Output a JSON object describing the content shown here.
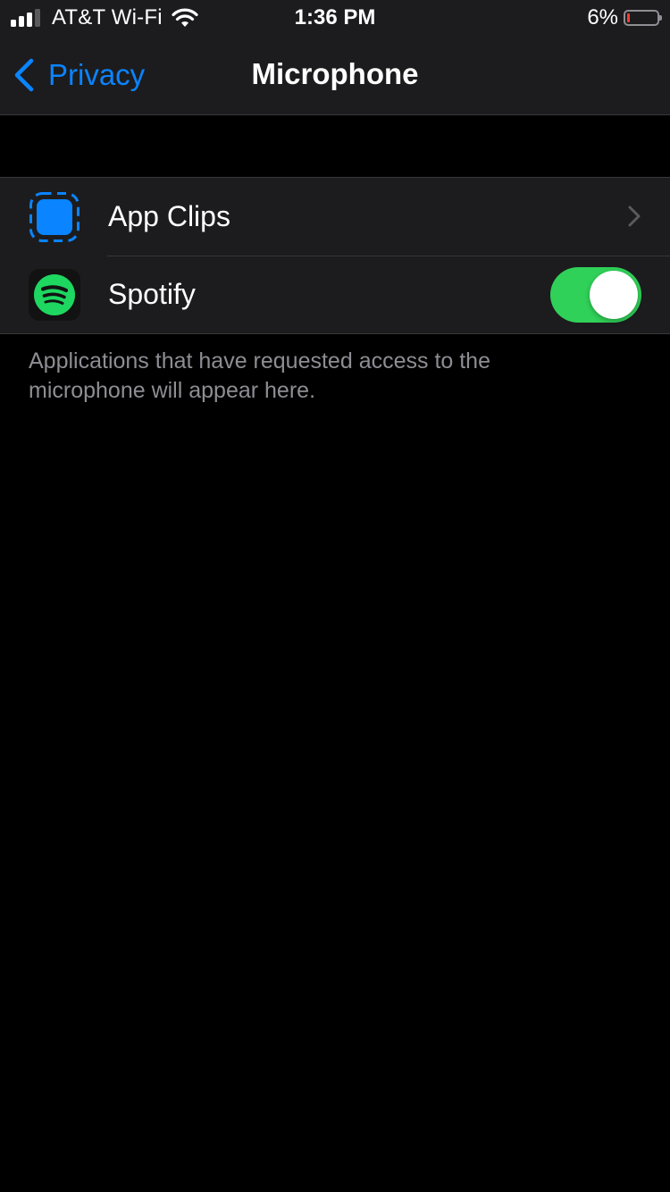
{
  "status_bar": {
    "carrier": "AT&T Wi-Fi",
    "time": "1:36 PM",
    "battery_percent": "6%",
    "battery_level": 0.06,
    "signal_bars": 3
  },
  "nav": {
    "back_label": "Privacy",
    "title": "Microphone"
  },
  "rows": [
    {
      "label": "App Clips",
      "icon": "app-clips-icon",
      "accessory": "chevron"
    },
    {
      "label": "Spotify",
      "icon": "spotify-icon",
      "accessory": "toggle",
      "toggle_on": true
    }
  ],
  "footer_note": "Applications that have requested access to the microphone will appear here.",
  "colors": {
    "accent": "#0a84ff",
    "toggle_on": "#30d158",
    "spotify_green": "#1ed760",
    "battery_low": "#ff3b30"
  }
}
